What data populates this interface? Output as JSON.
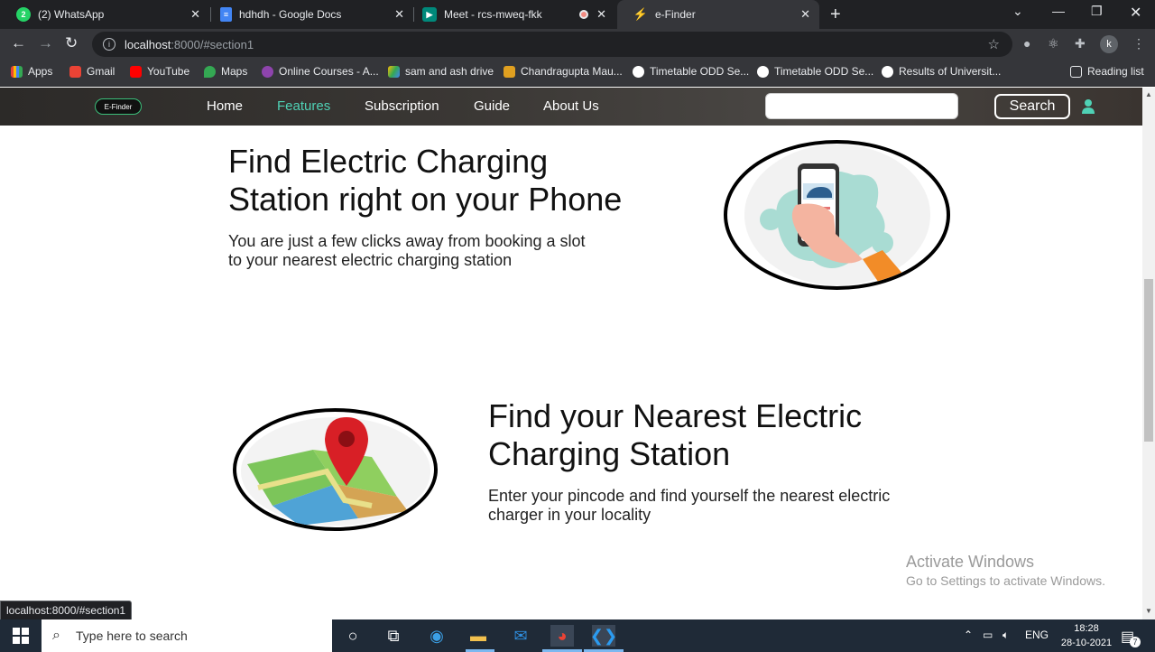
{
  "browser": {
    "tabs": [
      {
        "label": "(2) WhatsApp",
        "icon": "whatsapp-icon",
        "color": "#25d366"
      },
      {
        "label": "hdhdh - Google Docs",
        "icon": "google-docs-icon",
        "color": "#4285f4"
      },
      {
        "label": "Meet - rcs-mweq-fkk",
        "icon": "google-meet-icon",
        "color": "#00897b"
      },
      {
        "label": "e-Finder",
        "icon": "efinder-tab-icon",
        "color": "#4fd1b5"
      }
    ],
    "address": {
      "host": "localhost",
      "path": ":8000/#section1"
    },
    "bookmarks": [
      {
        "label": "Apps"
      },
      {
        "label": "Gmail"
      },
      {
        "label": "YouTube"
      },
      {
        "label": "Maps"
      },
      {
        "label": "Online Courses - A..."
      },
      {
        "label": "sam and ash drive"
      },
      {
        "label": "Chandragupta Mau..."
      },
      {
        "label": "Timetable ODD Se..."
      },
      {
        "label": "Timetable ODD Se..."
      },
      {
        "label": "Results of Universit..."
      }
    ],
    "reading_list": "Reading list",
    "profile_initial": "k",
    "status_url": "localhost:8000/#section1"
  },
  "site": {
    "logo_text": "E-Finder",
    "nav": [
      "Home",
      "Features",
      "Subscription",
      "Guide",
      "About Us"
    ],
    "search_button": "Search",
    "accent_color": "#4fd1b5"
  },
  "sections": [
    {
      "title_line1": "Find Electric Charging",
      "title_line2": "Station right on your Phone",
      "text_line1": "You are just a few clicks away from booking a slot",
      "text_line2": "to your nearest electric charging station"
    },
    {
      "title_line1": "Find your Nearest Electric",
      "title_line2": "Charging Station",
      "text_line1": "Enter your pincode and find yourself the nearest electric",
      "text_line2": "charger in your locality"
    }
  ],
  "watermark": {
    "line1": "Activate Windows",
    "line2": "Go to Settings to activate Windows."
  },
  "taskbar": {
    "search_placeholder": "Type here to search",
    "language": "ENG",
    "time": "18:28",
    "date": "28-10-2021",
    "notification_count": "7"
  }
}
